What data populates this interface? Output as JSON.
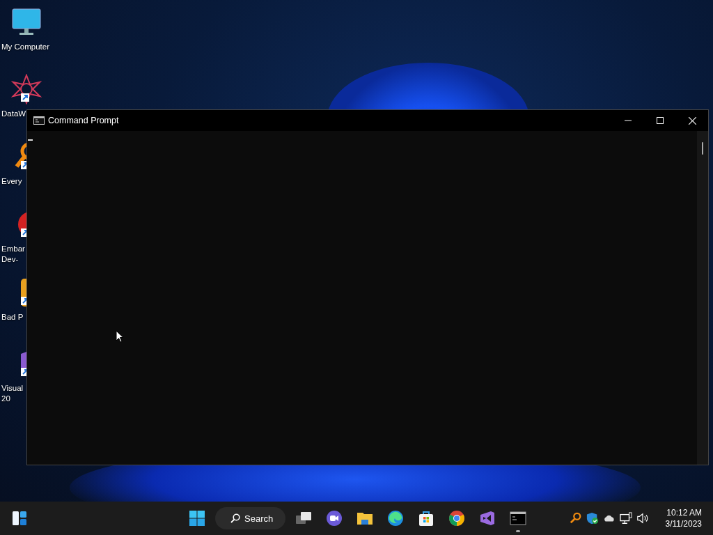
{
  "desktop_icons": [
    {
      "kind": "monitor",
      "lines": [
        "My Computer"
      ],
      "shortcut": false
    },
    {
      "kind": "star",
      "lines": [
        "DataW"
      ],
      "shortcut": true
    },
    {
      "kind": "magnifier",
      "lines": [
        "Every"
      ],
      "shortcut": true
    },
    {
      "kind": "badge",
      "lines": [
        "Embar",
        "Dev-"
      ],
      "shortcut": true
    },
    {
      "kind": "game",
      "lines": [
        "Bad P"
      ],
      "shortcut": true
    },
    {
      "kind": "studio",
      "lines": [
        "Visual",
        "20"
      ],
      "shortcut": true
    }
  ],
  "window": {
    "title": "Command Prompt"
  },
  "taskbar": {
    "search": {
      "label": "Search"
    },
    "apps": [
      {
        "kind": "taskview",
        "running": false
      },
      {
        "kind": "chat",
        "running": false
      },
      {
        "kind": "folder",
        "running": false
      },
      {
        "kind": "edge",
        "running": false
      },
      {
        "kind": "store",
        "running": false
      },
      {
        "kind": "chrome",
        "running": false
      },
      {
        "kind": "studio",
        "running": false
      },
      {
        "kind": "terminal",
        "running": true
      }
    ],
    "tray": [
      {
        "kind": "magnifier"
      },
      {
        "kind": "shield"
      },
      {
        "kind": "cloud"
      },
      {
        "kind": "network"
      },
      {
        "kind": "volume"
      }
    ],
    "time": "10:12 AM",
    "date": "3/11/2023"
  }
}
